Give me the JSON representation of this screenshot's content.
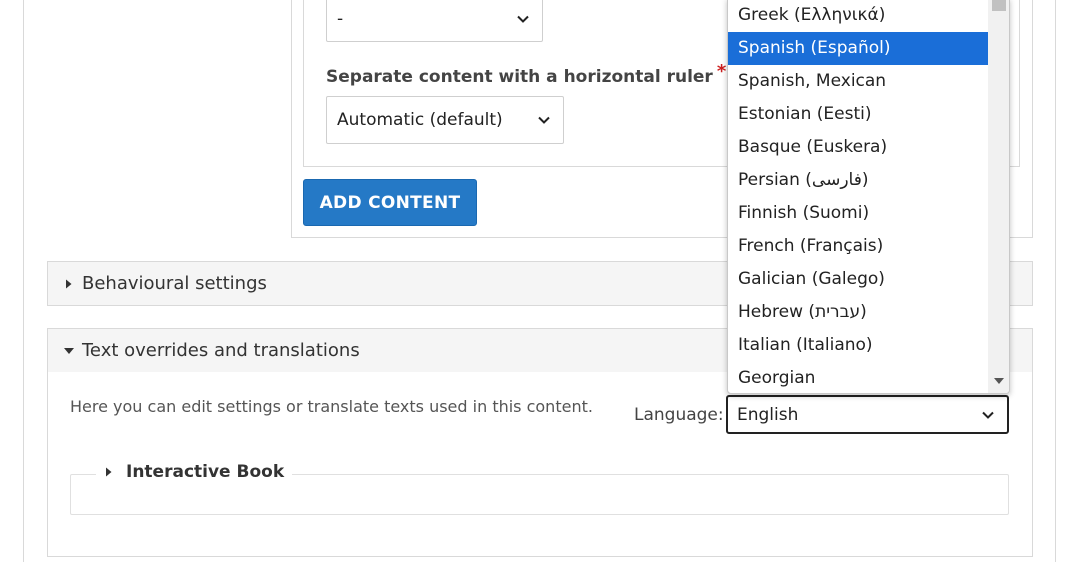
{
  "form": {
    "dash_select_value": "-",
    "ruler_label": "Separate content with a horizontal ruler",
    "required_mark": "*",
    "ruler_select_value": "Automatic (default)",
    "add_content_label": "ADD CONTENT"
  },
  "panels": {
    "behaviour_label": "Behavioural settings",
    "overrides_label": "Text overrides and translations"
  },
  "overrides": {
    "help_text": "Here you can edit settings or translate texts used in this content.",
    "language_label": "Language:",
    "language_value": "English",
    "book_legend": "Interactive Book"
  },
  "dropdown": {
    "options": [
      "Greek (Ελληνικά)",
      "Spanish (Español)",
      "Spanish, Mexican",
      "Estonian (Eesti)",
      "Basque (Euskera)",
      "Persian (فارسی)",
      "Finnish (Suomi)",
      "French (Français)",
      "Galician (Galego)",
      "Hebrew (עברית)",
      "Italian (Italiano)",
      "Georgian"
    ],
    "selected_index": 1
  },
  "icons": {
    "chevron": "chevron-down-icon",
    "collapsed": "triangle-right-icon",
    "expanded": "triangle-down-icon"
  },
  "colors": {
    "accent": "#2579c6",
    "selected_option": "#1a6ed8",
    "required": "#cc1f1f"
  }
}
